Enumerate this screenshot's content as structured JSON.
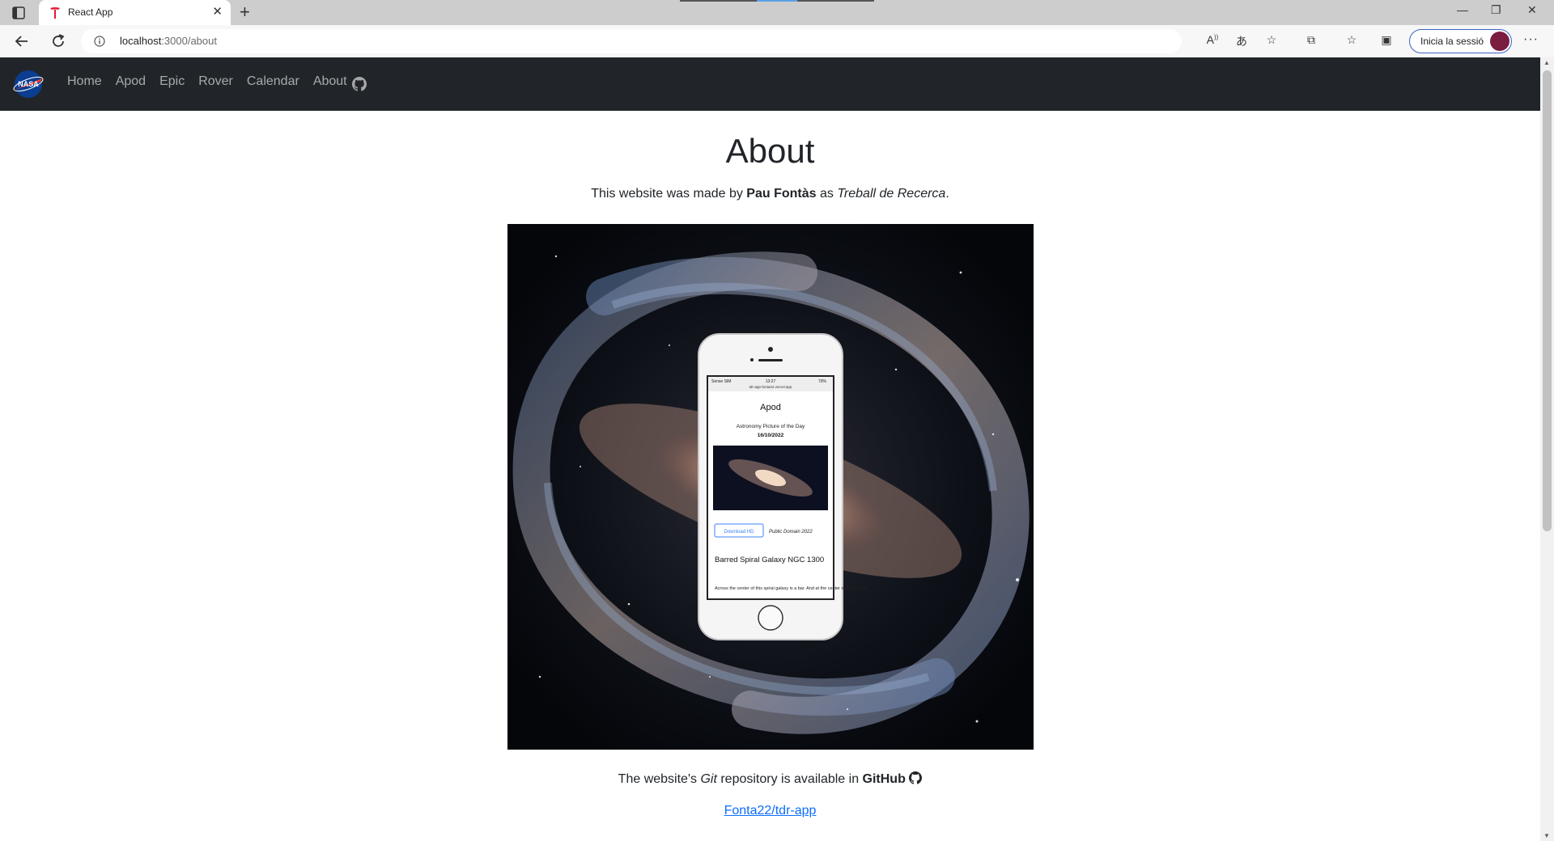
{
  "browser": {
    "tab_title": "React App",
    "url_host": "localhost",
    "url_rest": ":3000/about",
    "signin_label": "Inicia la sessió"
  },
  "navbar": {
    "logo_text": "NASA",
    "links": [
      "Home",
      "Apod",
      "Epic",
      "Rover",
      "Calendar",
      "About"
    ]
  },
  "page": {
    "title": "About",
    "byline_prefix": "This website was made by ",
    "author": "Pau Fontàs",
    "byline_mid": " as ",
    "project": "Treball de Recerca",
    "byline_suffix": ".",
    "footer_prefix": "The website's ",
    "footer_git": "Git",
    "footer_mid": " repository is available in ",
    "footer_github": "GitHub",
    "repo_link": "Fonta22/tdr-app"
  },
  "phone": {
    "status_carrier": "Sense SIM",
    "status_time": "13:27",
    "status_battery": "79%",
    "url": "tdr-app-fonta22.vercel.app",
    "heading": "Apod",
    "subtitle": "Astronomy Picture of the Day",
    "date": "16/10/2022",
    "download_button": "Download HD",
    "credit": "Public Domain 2022",
    "image_title": "Barred Spiral Galaxy NGC 1300",
    "description": "Across the center of this spiral galaxy is a bar. And at the center of this bar is"
  },
  "colors": {
    "navbar_bg": "#212529",
    "link": "#0d6efd",
    "signin_border": "#3a63c2"
  }
}
